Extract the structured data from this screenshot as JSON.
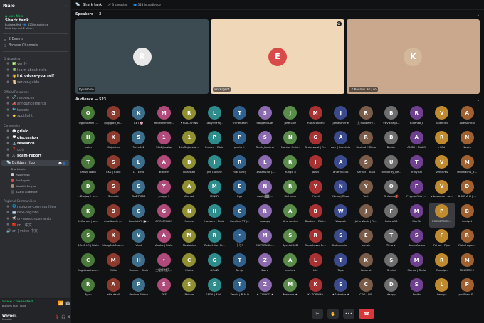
{
  "sidebar": {
    "server_name": "Rialo",
    "stage": {
      "live": "● Live Now",
      "name": "Shark tank",
      "meta1": "Builders Hub · 👥 523 in audience",
      "meta2": "Rialo Lap and 2 others"
    },
    "top_items": [
      {
        "icon": "☰",
        "label": "2 Events"
      },
      {
        "icon": "⊞",
        "label": "Browse Channels"
      }
    ],
    "categories": [
      {
        "name": "Onboarding",
        "channels": [
          {
            "icon": "#",
            "emoji": "✅",
            "label": "verify",
            "bold": false
          },
          {
            "icon": "#",
            "emoji": "📗",
            "label": "learn-about-rialo",
            "bold": false
          },
          {
            "icon": "#",
            "emoji": "👋",
            "label": "introduce-yourself",
            "bold": true
          },
          {
            "icon": "#",
            "emoji": "📜",
            "label": "server-guide",
            "bold": false
          }
        ]
      },
      {
        "name": "Official Resources",
        "channels": [
          {
            "icon": "#",
            "emoji": "🔗",
            "label": "resources",
            "bold": false
          },
          {
            "icon": "#",
            "emoji": "📣",
            "label": "announcements",
            "bold": false
          },
          {
            "icon": "#",
            "emoji": "🐦",
            "label": "tweets",
            "bold": false
          },
          {
            "icon": "#",
            "emoji": "⭐",
            "label": "spotlight",
            "bold": false
          }
        ]
      },
      {
        "name": "Community",
        "channels": [
          {
            "icon": "#",
            "emoji": "💬",
            "label": "grialo",
            "bold": true
          },
          {
            "icon": "#",
            "emoji": "💭",
            "label": "discussion",
            "bold": true
          },
          {
            "icon": "#",
            "emoji": "🔬",
            "label": "research",
            "bold": true
          },
          {
            "icon": "#",
            "emoji": "❓",
            "label": "quiz",
            "bold": false
          },
          {
            "icon": "#",
            "emoji": "⚠",
            "label": "scam-report",
            "bold": true
          }
        ]
      }
    ],
    "stage_channel": {
      "label": "Builders Hub",
      "sub": "Shark tank"
    },
    "stage_users": [
      "Ryuilim|so",
      "EricArgent",
      "Koushik Bir | so"
    ],
    "stage_more": "523 in audience",
    "categories2": [
      {
        "name": "Regional Communities",
        "channels": [
          {
            "icon": "#",
            "emoji": "🌐",
            "label": "regional-communities",
            "bold": false
          },
          {
            "icon": "#",
            "emoji": "🆕",
            "label": "new-regions",
            "bold": false
          },
          {
            "icon": "#",
            "emoji": "📢",
            "label": "cn-announcements",
            "bold": false
          },
          {
            "icon": "#",
            "emoji": "🇨🇳",
            "label": "cn | 中文",
            "bold": false
          },
          {
            "icon": "🔊",
            "emoji": "",
            "label": "cn | voice-中文",
            "bold": false
          }
        ]
      }
    ],
    "voice": {
      "status": "Voice Connected",
      "sub": "Builders Hub / Rialo"
    },
    "user": {
      "name": "Waynei.",
      "status": "Invisible"
    }
  },
  "topbar": {
    "title": "Shark tank",
    "speaking": "3 speaking",
    "audience": "523 in audience"
  },
  "speakers": {
    "heading": "Speakers — 3",
    "tiles": [
      {
        "label": "Ryuilim|so",
        "bg": "#3c4a52",
        "avatar_bg": "#e8e8e8",
        "initial": "R",
        "settings": false
      },
      {
        "label": "EricArgent",
        "bg": "#f0d7b8",
        "avatar_bg": "#d94a4a",
        "initial": "E",
        "settings": true
      },
      {
        "label": "🎤 Koushik Bir | so",
        "bg": "#c9a88e",
        "avatar_bg": "#d4b89c",
        "initial": "K",
        "settings": false
      }
    ]
  },
  "audience": {
    "heading": "Audience — 523",
    "members": [
      "Ogpindansi ...",
      "gugigi80_RI...",
      "KET 🌸",
      "mdmrrrrmrrr...",
      "✦RIALO FINA",
      "Libby!!!YM|...",
      "TheYeezam",
      "Sanpedi Das",
      "José Luiz",
      "madacobomi",
      "Jamesmerie",
      "🎗Rubberry...",
      "⛨bViEkaljo...",
      "Ridenko_r",
      "valentino",
      "Abelsamral",
      "hslim",
      "KluJunion",
      "5x1x3x2",
      "10xBJoestar",
      "10xGaJoestar...",
      "Punam | Rialo",
      "pairto ✦",
      "Shah_hasima",
      "Nahian Nahin",
      "Gravewest | R...",
      "Ace | Itachiolu",
      "Rezlaid ✦Rialo",
      "Bastar",
      "ANSH | RIALO",
      "r!l8d",
      "Nasim",
      "Tanvir Nabil",
      "SKS | Rialo",
      "Li TEINo",
      "atik.eth",
      "BitayBae",
      "JUST-ABOO",
      "Rial Tancy",
      "Lashan258 (...",
      "Rungo :)",
      "JAAN",
      "andrei0x45",
      "Serhat | Rialo",
      "UmNardy_BR...",
      "Trrkyishi",
      "Ventures",
      "muchacho_3...",
      "..Durjoy!! (n...",
      "Surabhi",
      "GADT 888",
      "yappp ✦",
      "Ahmad",
      "MINDY",
      "Ego",
      "noob(▒▒)...",
      "Richman",
      "!!Yekii",
      "Nimu | Rialo",
      "Yash",
      "Ohlanno🎒",
      "F1ppoofisia |...",
      "vibesories | ra...",
      "D 0 B A H | ...",
      "K.Guhan | ar...",
      "ddudboole (...",
      "GanduLiFi (●...",
      "GROMCHAIN",
      "Nzarte",
      "hossam | Rialo",
      "Caroline TT |...",
      "ralaupq",
      "Ana Andra",
      "Bostom | Rial...",
      "WayneL",
      "John Weck | RI...",
      "FuturaBB",
      "Marfik",
      "POCKETSIZE...",
      "bridget",
      "S.A.M.I.R | Rialo",
      "KangBokSoon...",
      "Vlad",
      "Asuka | Rialo",
      "Mostakim",
      "Robert Van D...",
      "十七Ξ",
      "MAYSONKIL...",
      "SpecialG0D",
      "Rialo Lover Pr...",
      "Statamania ✦",
      "eurah",
      "Tima ↙",
      "Snow Awass",
      "Fahad | Rjve",
      "Rahul Agar...",
      "Cagdasselsah...",
      "Millie",
      "Hasnur | Rialo",
      "工程师 钱亮...",
      "Chaks",
      "GOdZi",
      "Tamjo",
      "Zaira",
      "amitus",
      "LILI",
      "Tope",
      "Kanarot",
      "Shirini",
      "Marsal | Rialo",
      "Rudolph",
      "MINATO!!✦",
      "Ryuu",
      "affa.danil",
      "Paulina Fatma",
      "SKS",
      "Shinzo",
      "SAGA | Rial...",
      "Tanvir | RIALO",
      "★ ZANKIO ✦",
      "Marcoos ✦",
      "Kt ZORAMA",
      "✦Satoshia ✦",
      "CEO | WA",
      "dappy",
      "Smith",
      "Lamiya",
      "pic Rialo S..."
    ],
    "selected_index": 78
  },
  "controls": {
    "mute": "✂",
    "hand": "✋",
    "more": "•••",
    "leave": "☎"
  }
}
